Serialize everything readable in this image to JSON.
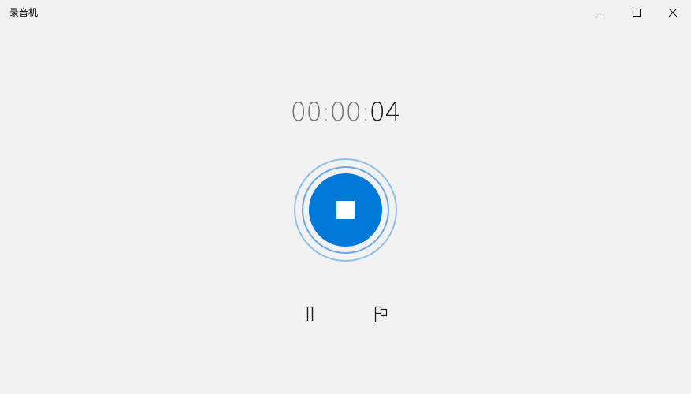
{
  "window": {
    "title": "录音机"
  },
  "titlebar_buttons": {
    "minimize_icon": "minimize-icon",
    "maximize_icon": "maximize-icon",
    "close_icon": "close-icon"
  },
  "timer": {
    "hours": "00",
    "minutes": "00",
    "seconds": "04",
    "separator": ":"
  },
  "controls": {
    "stop_icon": "stop-icon",
    "pause_icon": "pause-icon",
    "flag_icon": "flag-icon"
  },
  "colors": {
    "background": "#f2f2f2",
    "accent": "#0078d7",
    "ring_light": "#90bfe9",
    "ring_mid": "#6aa9e3",
    "timer_dim": "#777777",
    "timer_bright": "#1a1a1a"
  }
}
